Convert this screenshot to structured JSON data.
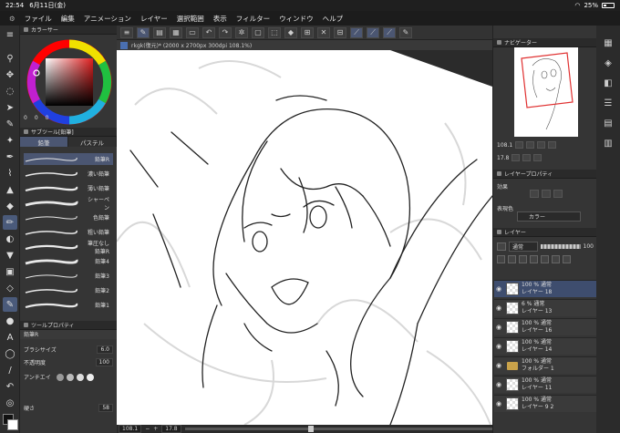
{
  "status": {
    "time": "22:54",
    "date": "6月11日(金)",
    "battery": "25%"
  },
  "menu": [
    "ファイル",
    "編集",
    "アニメーション",
    "レイヤー",
    "選択範囲",
    "表示",
    "フィルター",
    "ウィンドウ",
    "ヘルプ"
  ],
  "document_title": "rkgk(復元)* (2000 x 2700px 300dpi 108.1%)",
  "left": {
    "color_panel_title": "カラーサー",
    "color_values": [
      "0",
      "0",
      "0"
    ],
    "subtool_panel_title": "サブツール[鉛筆]",
    "subtool_tabs": [
      "鉛筆",
      "パステル"
    ],
    "brushes": [
      "鉛筆R",
      "濃い鉛筆",
      "薄い鉛筆",
      "シャーペン",
      "色鉛筆",
      "粗い鉛筆",
      "筆圧なし鉛筆R",
      "鉛筆4",
      "鉛筆3",
      "鉛筆2",
      "鉛筆1"
    ],
    "tool_property_title": "ツールプロパティ",
    "tool_property_brush": "鉛筆R",
    "props": [
      {
        "label": "ブラシサイズ",
        "value": "6.0"
      },
      {
        "label": "不透明度",
        "value": "100"
      },
      {
        "label": "アンチエイ",
        "value": ""
      },
      {
        "label": "硬さ",
        "value": "58"
      }
    ]
  },
  "right": {
    "navigator_title": "ナビゲーター",
    "nav_zoom": "108.1",
    "nav_rotate": "17.8",
    "layer_property_title": "レイヤープロパティ",
    "effect_label": "効果",
    "color_label": "表現色",
    "color_value": "カラー",
    "layer_title": "レイヤー",
    "blend_mode": "通常",
    "opacity": "100",
    "layers": [
      {
        "opacity": "100 % 通常",
        "name": "レイヤー 18",
        "selected": true,
        "folder": false
      },
      {
        "opacity": "6 % 通常",
        "name": "レイヤー 13",
        "selected": false,
        "folder": false
      },
      {
        "opacity": "100 % 通常",
        "name": "レイヤー 16",
        "selected": false,
        "folder": false
      },
      {
        "opacity": "100 % 通常",
        "name": "レイヤー 14",
        "selected": false,
        "folder": false
      },
      {
        "opacity": "100 % 通常",
        "name": "フォルダー 1",
        "selected": false,
        "folder": true
      },
      {
        "opacity": "100 % 通常",
        "name": "レイヤー 11",
        "selected": false,
        "folder": false
      },
      {
        "opacity": "100 % 通常",
        "name": "レイヤー 9 2",
        "selected": false,
        "folder": false
      }
    ]
  },
  "bottom": {
    "zoom": "108.1",
    "rotate": "17.8"
  }
}
